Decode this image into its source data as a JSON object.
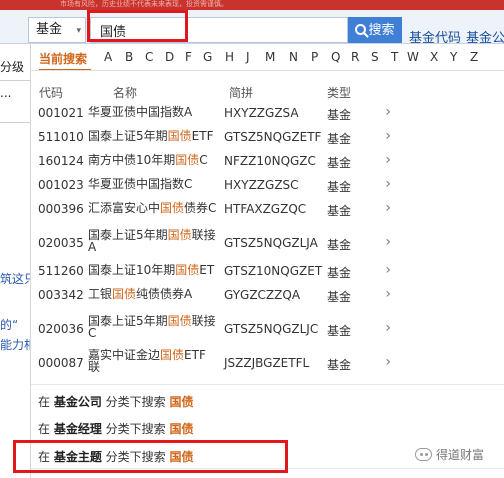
{
  "topbar": {
    "notice": "市场有风险，历史业绩不代表未来表现，投资需谨慎。"
  },
  "search": {
    "scope_value": "基金",
    "query": "国债",
    "button_label": "搜索",
    "links": [
      "基金代码",
      "基金公司"
    ]
  },
  "left_page": {
    "texts": [
      "分级",
      "...",
      "筑这只",
      "的“",
      "能力相"
    ]
  },
  "letter_nav": {
    "current": "当前搜索",
    "letters": [
      "A",
      "B",
      "C",
      "D",
      "F",
      "G",
      "H",
      "J",
      "M",
      "N",
      "P",
      "Q",
      "R",
      "S",
      "T",
      "W",
      "X",
      "Y",
      "Z"
    ]
  },
  "columns": {
    "code": "代码",
    "name": "名称",
    "pinyin": "简拼",
    "type": "类型"
  },
  "results": [
    {
      "code": "001021",
      "name_pre": "华夏亚债中国指数A",
      "name_hl": "",
      "name_post": "",
      "pinyin": "HXYZZGZSA",
      "type": "基金"
    },
    {
      "code": "511010",
      "name_pre": "国泰上证5年期",
      "name_hl": "国债",
      "name_post": "ETF",
      "pinyin": "GTSZ5NQGZETF",
      "type": "基金"
    },
    {
      "code": "160124",
      "name_pre": "南方中债10年期",
      "name_hl": "国债",
      "name_post": "C",
      "pinyin": "NFZZ10NQGZC",
      "type": "基金"
    },
    {
      "code": "001023",
      "name_pre": "华夏亚债中国指数C",
      "name_hl": "",
      "name_post": "",
      "pinyin": "HXYZZGZSC",
      "type": "基金"
    },
    {
      "code": "000396",
      "name_pre": "汇添富安心中",
      "name_hl": "国债",
      "name_post": "债券C",
      "pinyin": "HTFAXZGZQC",
      "type": "基金"
    },
    {
      "code": "020035",
      "name_pre": "国泰上证5年期",
      "name_hl": "国债",
      "name_post": "联接",
      "name_line2": "A",
      "pinyin": "GTSZ5NQGZLJA",
      "type": "基金"
    },
    {
      "code": "511260",
      "name_pre": "国泰上证10年期",
      "name_hl": "国债",
      "name_post": "ET",
      "pinyin": "GTSZ10NQGZET",
      "type": "基金"
    },
    {
      "code": "003342",
      "name_pre": "工银",
      "name_hl": "国债",
      "name_post": "纯债债券A",
      "pinyin": "GYGZCZZQA",
      "type": "基金"
    },
    {
      "code": "020036",
      "name_pre": "国泰上证5年期",
      "name_hl": "国债",
      "name_post": "联接",
      "name_line2": "C",
      "pinyin": "GTSZ5NQGZLJC",
      "type": "基金"
    },
    {
      "code": "000087",
      "name_pre": "嘉实中证金边",
      "name_hl": "国债",
      "name_post": "ETF",
      "name_line2": "联",
      "pinyin": "JSZZJBGZETFL",
      "type": "基金"
    }
  ],
  "categories": [
    {
      "prefix": "在 ",
      "category": "基金公司",
      "middle": " 分类下搜索 ",
      "keyword": "国债"
    },
    {
      "prefix": "在 ",
      "category": "基金经理",
      "middle": " 分类下搜索 ",
      "keyword": "国债"
    },
    {
      "prefix": "在 ",
      "category": "基金主题",
      "middle": " 分类下搜索 ",
      "keyword": "国债"
    }
  ],
  "watermark": "得道财富",
  "colors": {
    "highlight": "#d0661a",
    "link": "#1a4e9a",
    "search_button": "#3f7fd6",
    "annotation_box": "#e0181e",
    "topbar": "#c9332d"
  }
}
